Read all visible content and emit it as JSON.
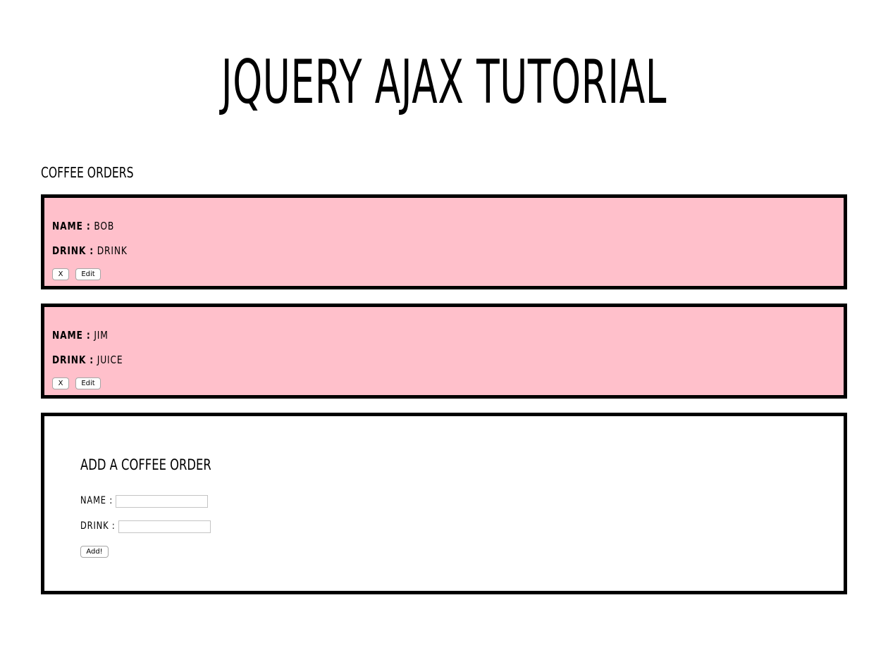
{
  "header": {
    "title": "JQUERY AJAX TUTORIAL"
  },
  "orders_section": {
    "heading": "COFFEE ORDERS",
    "orders": [
      {
        "name_label": "NAME :",
        "name": "BOB",
        "drink_label": "DRINK :",
        "drink": "DRINK",
        "delete_label": "X",
        "edit_label": "Edit"
      },
      {
        "name_label": "NAME :",
        "name": "JIM",
        "drink_label": "DRINK :",
        "drink": "JUICE",
        "delete_label": "X",
        "edit_label": "Edit"
      }
    ]
  },
  "add_form": {
    "heading": "ADD A COFFEE ORDER",
    "name_label": "NAME :",
    "name_value": "",
    "drink_label": "DRINK :",
    "drink_value": "",
    "submit_label": "Add!"
  },
  "colors": {
    "card_background": "#ffc0cb",
    "border": "#000000"
  }
}
